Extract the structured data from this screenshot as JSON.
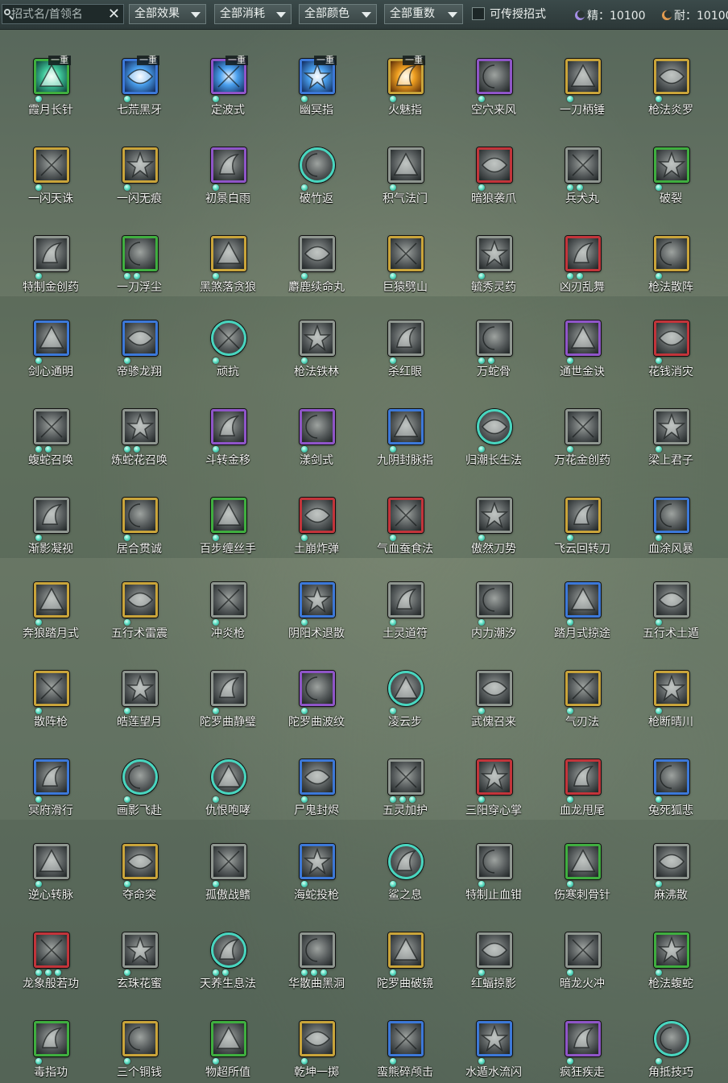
{
  "toolbar": {
    "search": {
      "placeholder": "招式名/首领名",
      "value": "",
      "clear_icon": "close-icon"
    },
    "filters": [
      {
        "key": "effect",
        "label": "全部效果"
      },
      {
        "key": "cost",
        "label": "全部消耗"
      },
      {
        "key": "color",
        "label": "全部颜色"
      },
      {
        "key": "tier",
        "label": "全部重数"
      }
    ],
    "teachable": {
      "label": "可传授招式",
      "checked": false
    },
    "resources": {
      "spirit": {
        "label": "精：10100",
        "icon": "spirit-icon",
        "color": "#a48ee6"
      },
      "endurance": {
        "label": "耐：10100",
        "icon": "endurance-icon",
        "color": "#e39b4f"
      }
    }
  },
  "frame_colors": {
    "gold": "#c9a43a",
    "grey": "#8f9690",
    "purple": "#8f55c8",
    "blue": "#3c78d8",
    "green": "#3fae3f",
    "red": "#c2343a",
    "teal": "#48d6bf"
  },
  "skills": [
    {
      "name": "霞月长针",
      "frame": "green",
      "dots": 1,
      "tier": "一重",
      "art": "burst-green"
    },
    {
      "name": "七荒黑牙",
      "frame": "blue",
      "dots": 1,
      "tier": "一重",
      "art": "burst-blue"
    },
    {
      "name": "定波式",
      "frame": "purple",
      "dots": 1,
      "tier": "一重",
      "art": "burst-blue"
    },
    {
      "name": "幽冥指",
      "frame": "blue",
      "dots": 1,
      "tier": "一重",
      "art": "burst-blue"
    },
    {
      "name": "火魅指",
      "frame": "gold",
      "dots": 1,
      "tier": "一重",
      "art": "burst-gold"
    },
    {
      "name": "空穴来风",
      "frame": "purple",
      "dots": 1
    },
    {
      "name": "一刀柄锤",
      "frame": "gold",
      "dots": 1
    },
    {
      "name": "枪法炎罗",
      "frame": "gold",
      "dots": 1
    },
    {
      "name": "一闪天诛",
      "frame": "gold",
      "dots": 1
    },
    {
      "name": "一闪无痕",
      "frame": "gold",
      "dots": 1
    },
    {
      "name": "初景白雨",
      "frame": "purple",
      "dots": 1
    },
    {
      "name": "破竹返",
      "frame": "teal",
      "dots": 1,
      "round": true
    },
    {
      "name": "积气法门",
      "frame": "grey",
      "dots": 1
    },
    {
      "name": "暗狼袭爪",
      "frame": "red",
      "dots": 1
    },
    {
      "name": "兵犬丸",
      "frame": "grey",
      "dots": 2
    },
    {
      "name": "破裂",
      "frame": "green",
      "dots": 1
    },
    {
      "name": "特制金创药",
      "frame": "grey",
      "dots": 1
    },
    {
      "name": "一刀浮尘",
      "frame": "green",
      "dots": 2
    },
    {
      "name": "黑煞落贪狼",
      "frame": "gold",
      "dots": 1
    },
    {
      "name": "麝鹿续命丸",
      "frame": "grey",
      "dots": 1
    },
    {
      "name": "巨猿劈山",
      "frame": "gold",
      "dots": 1
    },
    {
      "name": "毓秀灵药",
      "frame": "grey",
      "dots": 1
    },
    {
      "name": "凶刃乱舞",
      "frame": "red",
      "dots": 2
    },
    {
      "name": "枪法散阵",
      "frame": "gold",
      "dots": 1
    },
    {
      "name": "剑心通明",
      "frame": "blue",
      "dots": 1
    },
    {
      "name": "帝骖龙翔",
      "frame": "blue",
      "dots": 1
    },
    {
      "name": "顽抗",
      "frame": "teal",
      "dots": 1,
      "round": true
    },
    {
      "name": "枪法铁林",
      "frame": "grey",
      "dots": 1
    },
    {
      "name": "杀红眼",
      "frame": "grey",
      "dots": 1
    },
    {
      "name": "万蛇骨",
      "frame": "grey",
      "dots": 2
    },
    {
      "name": "通世金诀",
      "frame": "purple",
      "dots": 1
    },
    {
      "name": "花钱消灾",
      "frame": "red",
      "dots": 1
    },
    {
      "name": "蝮蛇召唤",
      "frame": "grey",
      "dots": 2
    },
    {
      "name": "炼蛇花召唤",
      "frame": "grey",
      "dots": 2
    },
    {
      "name": "斗转金移",
      "frame": "purple",
      "dots": 1
    },
    {
      "name": "漾剑式",
      "frame": "purple",
      "dots": 1
    },
    {
      "name": "九阴封脉指",
      "frame": "blue",
      "dots": 1
    },
    {
      "name": "归潮长生法",
      "frame": "teal",
      "dots": 1,
      "round": true
    },
    {
      "name": "万花金创药",
      "frame": "grey",
      "dots": 1
    },
    {
      "name": "梁上君子",
      "frame": "grey",
      "dots": 1
    },
    {
      "name": "渐影凝视",
      "frame": "grey",
      "dots": 1
    },
    {
      "name": "居合贯诚",
      "frame": "gold",
      "dots": 1
    },
    {
      "name": "百步缠丝手",
      "frame": "green",
      "dots": 1
    },
    {
      "name": "土崩炸弹",
      "frame": "red",
      "dots": 1
    },
    {
      "name": "气血蚕食法",
      "frame": "red",
      "dots": 1
    },
    {
      "name": "傲然刀势",
      "frame": "grey",
      "dots": 1
    },
    {
      "name": "飞云回转刀",
      "frame": "gold",
      "dots": 1
    },
    {
      "name": "血涂风暴",
      "frame": "blue",
      "dots": 1
    },
    {
      "name": "奔狼踏月式",
      "frame": "gold",
      "dots": 1
    },
    {
      "name": "五行术雷震",
      "frame": "gold",
      "dots": 1
    },
    {
      "name": "冲炎枪",
      "frame": "grey",
      "dots": 1
    },
    {
      "name": "阴阳术退散",
      "frame": "blue",
      "dots": 1
    },
    {
      "name": "土灵道符",
      "frame": "grey",
      "dots": 1
    },
    {
      "name": "内力潮汐",
      "frame": "grey",
      "dots": 1
    },
    {
      "name": "踏月式掠途",
      "frame": "blue",
      "dots": 1
    },
    {
      "name": "五行术土遁",
      "frame": "grey",
      "dots": 1
    },
    {
      "name": "散阵枪",
      "frame": "gold",
      "dots": 1
    },
    {
      "name": "皓莲望月",
      "frame": "grey",
      "dots": 1
    },
    {
      "name": "陀罗曲静璧",
      "frame": "grey",
      "dots": 1
    },
    {
      "name": "陀罗曲波纹",
      "frame": "purple",
      "dots": 1
    },
    {
      "name": "凌云步",
      "frame": "teal",
      "dots": 1,
      "round": true
    },
    {
      "name": "武傀召来",
      "frame": "grey",
      "dots": 1
    },
    {
      "name": "气刃法",
      "frame": "gold",
      "dots": 1
    },
    {
      "name": "枪断晴川",
      "frame": "gold",
      "dots": 1
    },
    {
      "name": "冥府滑行",
      "frame": "blue",
      "dots": 1
    },
    {
      "name": "画影飞赴",
      "frame": "teal",
      "dots": 1,
      "round": true
    },
    {
      "name": "仇恨咆哮",
      "frame": "teal",
      "dots": 1,
      "round": true
    },
    {
      "name": "尸鬼封烬",
      "frame": "blue",
      "dots": 1
    },
    {
      "name": "五灵加护",
      "frame": "grey",
      "dots": 3
    },
    {
      "name": "三阳穿心掌",
      "frame": "red",
      "dots": 1
    },
    {
      "name": "血龙甩尾",
      "frame": "red",
      "dots": 1
    },
    {
      "name": "兔死狐悲",
      "frame": "blue",
      "dots": 1
    },
    {
      "name": "逆心转脉",
      "frame": "grey",
      "dots": 1
    },
    {
      "name": "夺命突",
      "frame": "gold",
      "dots": 1
    },
    {
      "name": "孤傲战鳍",
      "frame": "grey",
      "dots": 1
    },
    {
      "name": "海蛇投枪",
      "frame": "blue",
      "dots": 1
    },
    {
      "name": "鲨之息",
      "frame": "teal",
      "dots": 1,
      "round": true
    },
    {
      "name": "特制止血钳",
      "frame": "grey",
      "dots": 1
    },
    {
      "name": "伤寒刺骨针",
      "frame": "green",
      "dots": 1
    },
    {
      "name": "麻沸散",
      "frame": "grey",
      "dots": 1
    },
    {
      "name": "龙象般若功",
      "frame": "red",
      "dots": 3
    },
    {
      "name": "玄珠花蜜",
      "frame": "grey",
      "dots": 1
    },
    {
      "name": "天养生息法",
      "frame": "teal",
      "dots": 2,
      "round": true
    },
    {
      "name": "华散曲黑洞",
      "frame": "grey",
      "dots": 3
    },
    {
      "name": "陀罗曲破镜",
      "frame": "gold",
      "dots": 1
    },
    {
      "name": "红蝠掠影",
      "frame": "grey",
      "dots": 1
    },
    {
      "name": "暗龙火冲",
      "frame": "grey",
      "dots": 1
    },
    {
      "name": "枪法蝮蛇",
      "frame": "green",
      "dots": 1
    },
    {
      "name": "毒指功",
      "frame": "green",
      "dots": 1
    },
    {
      "name": "三个铜钱",
      "frame": "gold",
      "dots": 1
    },
    {
      "name": "物超所值",
      "frame": "green",
      "dots": 1
    },
    {
      "name": "乾坤一掷",
      "frame": "gold",
      "dots": 1
    },
    {
      "name": "蛮熊碎颅击",
      "frame": "blue",
      "dots": 1
    },
    {
      "name": "水遁水流闪",
      "frame": "blue",
      "dots": 1
    },
    {
      "name": "疯狂疾走",
      "frame": "purple",
      "dots": 1
    },
    {
      "name": "角抵技巧",
      "frame": "teal",
      "dots": 1,
      "round": true
    }
  ]
}
